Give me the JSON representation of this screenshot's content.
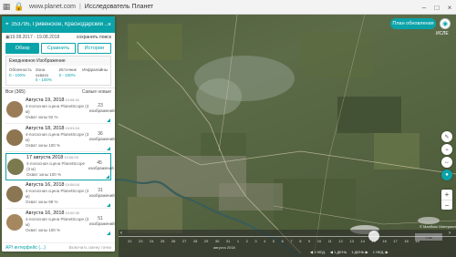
{
  "browser": {
    "url": "www.planet.com",
    "separator": "|",
    "page_title": "Исследователь Планет",
    "icons": [
      "grid-icon",
      "lock-icon"
    ],
    "window": [
      "–",
      "□",
      "×"
    ]
  },
  "panel": {
    "search_title": "353795, Гривенское, Краснодарский ...",
    "date_range": "19.08.2017 - 19.08.2018",
    "save_search": "сохранить поиск",
    "tabs": [
      {
        "label": "Обзор",
        "active": true
      },
      {
        "label": "Сравнить",
        "active": false
      },
      {
        "label": "Истории",
        "active": false
      }
    ],
    "filters_header": "Ежедневное Изображение",
    "filters": [
      {
        "label": "Облачность",
        "range": "0 - 100%"
      },
      {
        "label": "Зона охвата",
        "range": "0 - 100%"
      },
      {
        "label": "Источник",
        "range": "0 - 100%"
      },
      {
        "label": "Инфралайны",
        "range": ""
      }
    ],
    "list_count": "Все (365)",
    "list_sort": "Самые новые",
    "cards": [
      {
        "date": "Августа 19, 2018",
        "time": "10:08:31",
        "desc": "4-полосная сцена PlanetScope (3 м)",
        "sub": "Охват зоны 92 %",
        "count": "23",
        "count_label": "изображений",
        "thumb": "#9a7d58",
        "selected": false
      },
      {
        "date": "Августа 18, 2018",
        "time": "10:03:24",
        "desc": "4-полосная сцена PlanetScope (3 м)",
        "sub": "Охват зоны 100 %",
        "count": "36",
        "count_label": "изображений",
        "thumb": "#8e7550",
        "selected": false
      },
      {
        "date": "17 августа 2018",
        "time": "10:06:00",
        "desc": "4-полосная сцена PlanetScope (3 м)",
        "sub": "Охват зоны 100 %",
        "count": "45",
        "count_label": "изображений",
        "thumb": "#7a7a4e",
        "selected": true
      },
      {
        "date": "Августа 16, 2018",
        "time": "10:08:04",
        "desc": "4-полосная сцена PlanetScope (3 м)",
        "sub": "Охват зоны 99 %",
        "count": "31",
        "count_label": "изображений",
        "thumb": "#8a7653",
        "selected": false
      },
      {
        "date": "Августа 16, 2018",
        "time": "10:00:30",
        "desc": "4-полосная сцена PlanetScope (3 м)",
        "sub": "Охват зоны 100 %",
        "count": "51",
        "count_label": "изображений",
        "thumb": "#a58860",
        "selected": false
      }
    ],
    "api_link": "API интерфейс (...)",
    "api_extra": "Включить смену точки"
  },
  "topright": {
    "plan_button": "План обновления",
    "account": "ИСЛЕ"
  },
  "timeline": {
    "days": [
      "22",
      "23",
      "24",
      "25",
      "26",
      "27",
      "28",
      "29",
      "30",
      "31",
      "1",
      "2",
      "3",
      "4",
      "5",
      "6",
      "7",
      "8",
      "9",
      "10",
      "11",
      "12",
      "13",
      "14",
      "15",
      "16",
      "17",
      "18",
      "19"
    ],
    "month": "августа 2018",
    "controls": [
      "◀ 1 НЕД.",
      "◀ 1 ДЕНЬ",
      "1 ДЕНЬ ▶",
      "1 НЕД. ▶"
    ],
    "credit": "© Мапбокс Материал",
    "scale": "1 км"
  },
  "colors": {
    "accent": "#0aa3a9"
  }
}
